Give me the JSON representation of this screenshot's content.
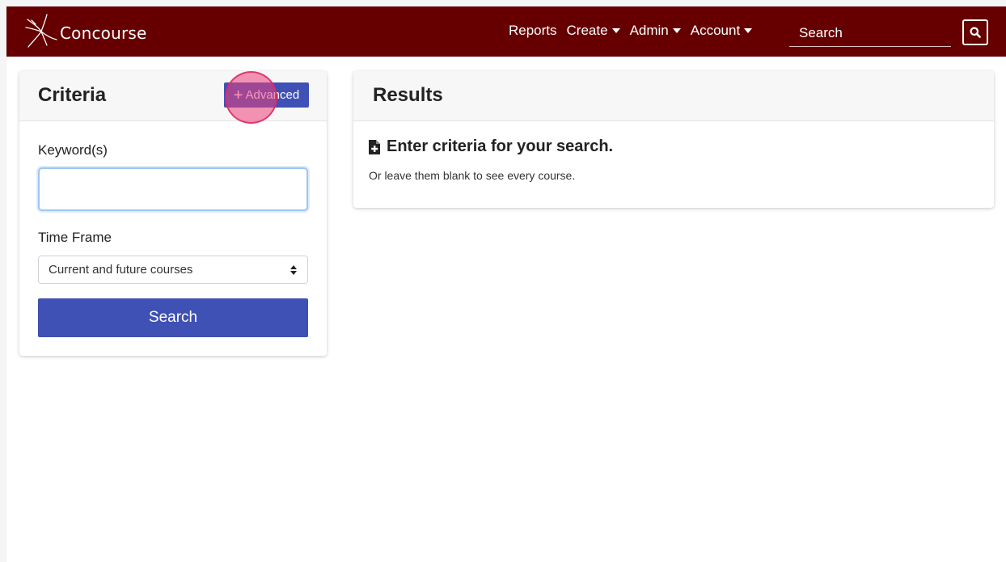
{
  "navbar": {
    "brand": "Concourse",
    "links": [
      {
        "label": "Reports",
        "dropdown": false
      },
      {
        "label": "Create",
        "dropdown": true
      },
      {
        "label": "Admin",
        "dropdown": true
      },
      {
        "label": "Account",
        "dropdown": true
      }
    ],
    "search_placeholder": "Search",
    "colors": {
      "background": "#660000"
    }
  },
  "criteria": {
    "title": "Criteria",
    "advanced_label": "Advanced",
    "keyword_label": "Keyword(s)",
    "keyword_value": "",
    "timeframe_label": "Time Frame",
    "timeframe_selected": "Current and future courses",
    "search_label": "Search"
  },
  "results": {
    "title": "Results",
    "heading": "Enter criteria for your search.",
    "subtext": "Or leave them blank to see every course."
  },
  "colors": {
    "primary_button": "#3f51b5",
    "click_indicator": "#ec407a"
  }
}
